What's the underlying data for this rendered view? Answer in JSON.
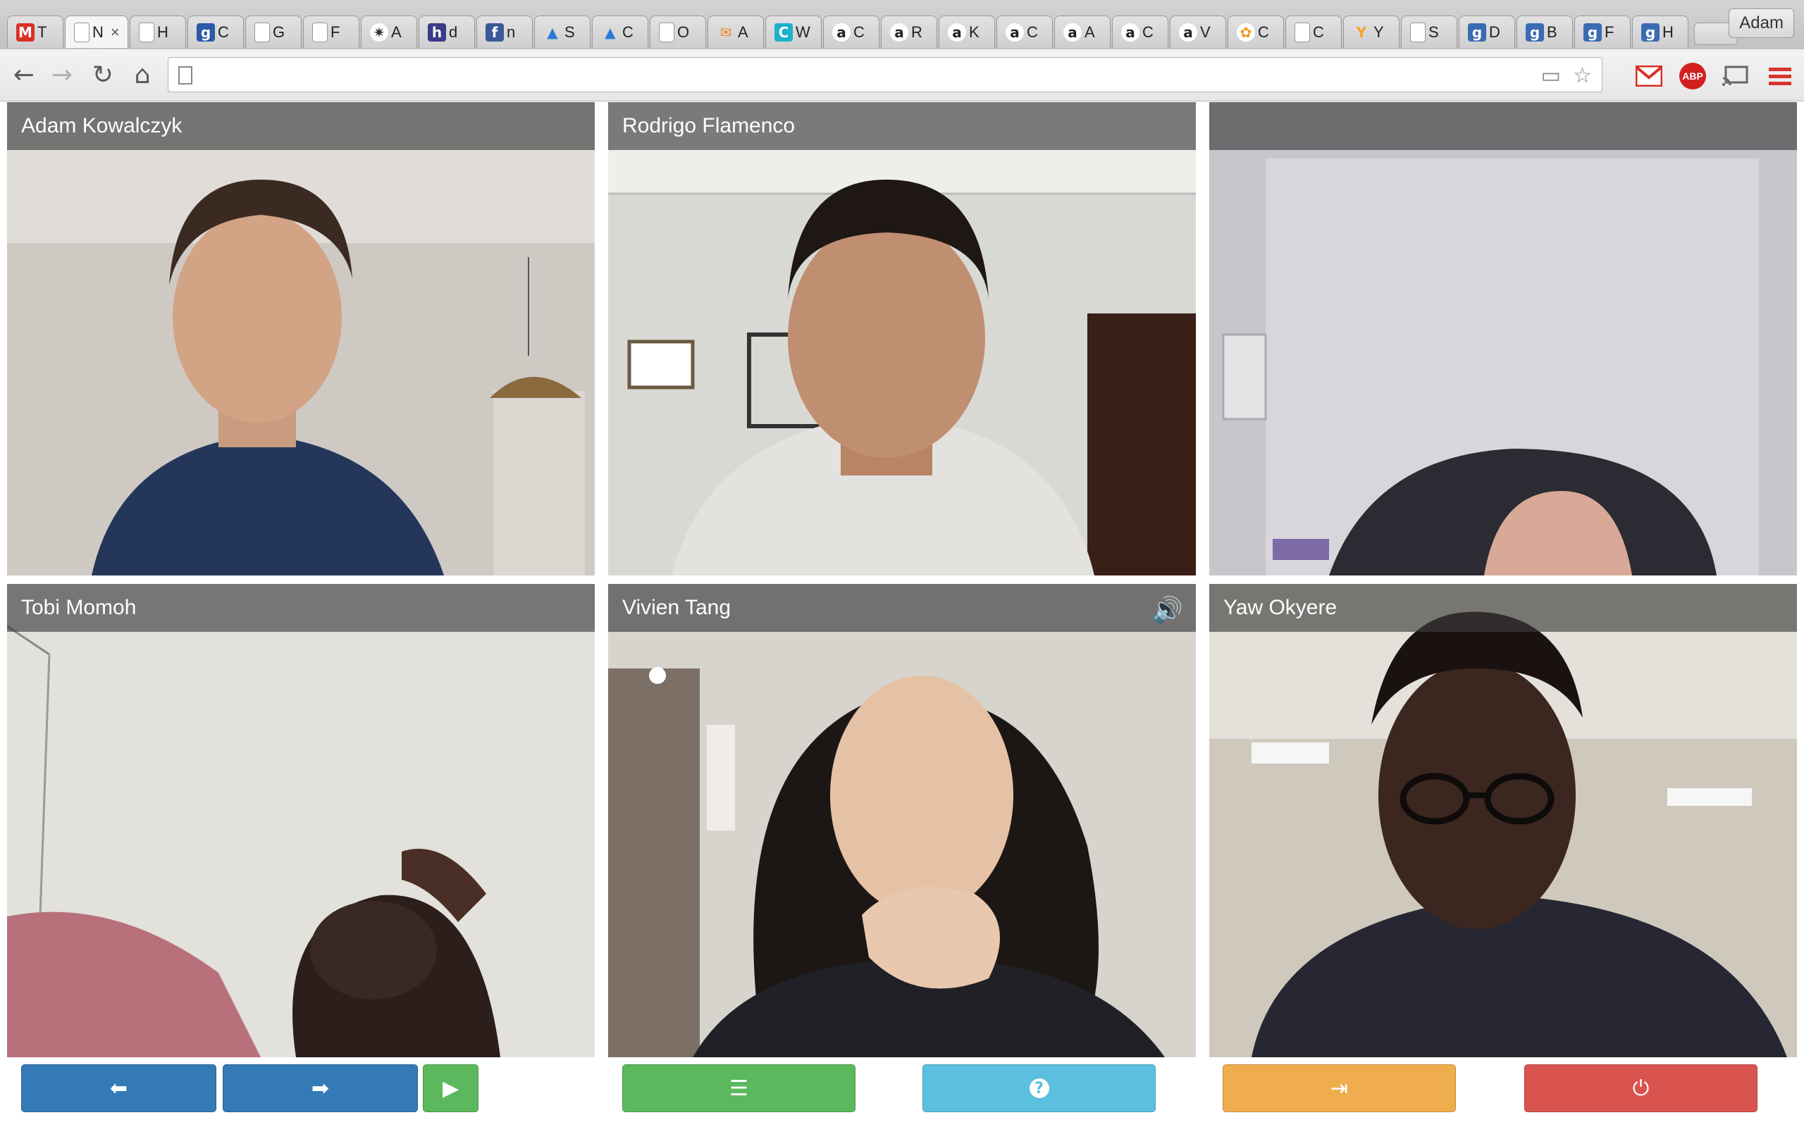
{
  "browser": {
    "profile_name": "Adam",
    "address": "",
    "tabs": [
      {
        "favicon": "gmail-icon",
        "glyph": "M",
        "color": "#d93025",
        "label": "T"
      },
      {
        "favicon": "page-icon",
        "glyph": "",
        "color": "#ffffff",
        "label": "N",
        "active": true
      },
      {
        "favicon": "apple-icon",
        "glyph": "",
        "color": "#555555",
        "label": "H"
      },
      {
        "favicon": "g-logo-icon",
        "glyph": "g",
        "color": "#2a5aa8",
        "label": "C"
      },
      {
        "favicon": "document-icon",
        "glyph": "",
        "color": "#ffffff",
        "label": "G"
      },
      {
        "favicon": "document-icon",
        "glyph": "",
        "color": "#ffffff",
        "label": "F"
      },
      {
        "favicon": "star-burst-icon",
        "glyph": "✷",
        "color": "#333333",
        "label": "A"
      },
      {
        "favicon": "h-logo-icon",
        "glyph": "h",
        "color": "#3b3a8a",
        "label": "d"
      },
      {
        "favicon": "facebook-icon",
        "glyph": "f",
        "color": "#3b5998",
        "label": "n"
      },
      {
        "favicon": "triangle-icon",
        "glyph": "▲",
        "color": "#2b7bd6",
        "label": "S"
      },
      {
        "favicon": "triangle-icon",
        "glyph": "▲",
        "color": "#2b7bd6",
        "label": "C"
      },
      {
        "favicon": "document-icon",
        "glyph": "",
        "color": "#ffffff",
        "label": "O"
      },
      {
        "favicon": "envelope-icon",
        "glyph": "✉",
        "color": "#f08a24",
        "label": "A"
      },
      {
        "favicon": "c-logo-icon",
        "glyph": "C",
        "color": "#1bb3c8",
        "label": "W"
      },
      {
        "favicon": "amazon-icon",
        "glyph": "a",
        "color": "#222222",
        "label": "C"
      },
      {
        "favicon": "amazon-icon",
        "glyph": "a",
        "color": "#222222",
        "label": "R"
      },
      {
        "favicon": "amazon-icon",
        "glyph": "a",
        "color": "#222222",
        "label": "K"
      },
      {
        "favicon": "amazon-icon",
        "glyph": "a",
        "color": "#222222",
        "label": "C"
      },
      {
        "favicon": "amazon-icon",
        "glyph": "a",
        "color": "#222222",
        "label": "A"
      },
      {
        "favicon": "amazon-icon",
        "glyph": "a",
        "color": "#222222",
        "label": "C"
      },
      {
        "favicon": "amazon-icon",
        "glyph": "a",
        "color": "#222222",
        "label": "V"
      },
      {
        "favicon": "puzzle-icon",
        "glyph": "✿",
        "color": "#f09a1a",
        "label": "C"
      },
      {
        "favicon": "document-icon",
        "glyph": "",
        "color": "#ffffff",
        "label": "C"
      },
      {
        "favicon": "y-logo-icon",
        "glyph": "Y",
        "color": "#f5a623",
        "label": "Y"
      },
      {
        "favicon": "document-icon",
        "glyph": "",
        "color": "#ffffff",
        "label": "S"
      },
      {
        "favicon": "goodreads-icon",
        "glyph": "g",
        "color": "#3b6bb3",
        "label": "D"
      },
      {
        "favicon": "goodreads-icon",
        "glyph": "g",
        "color": "#3b6bb3",
        "label": "B"
      },
      {
        "favicon": "goodreads-icon",
        "glyph": "g",
        "color": "#3b6bb3",
        "label": "F"
      },
      {
        "favicon": "goodreads-icon",
        "glyph": "g",
        "color": "#3b6bb3",
        "label": "H"
      }
    ]
  },
  "participants": [
    {
      "name": "Adam Kowalczyk",
      "speaking": false
    },
    {
      "name": "Rodrigo Flamenco",
      "speaking": false
    },
    {
      "name": "",
      "speaking": false
    },
    {
      "name": "Tobi Momoh",
      "speaking": false
    },
    {
      "name": "Vivien Tang",
      "speaking": true
    },
    {
      "name": "Yaw Okyere",
      "speaking": false
    }
  ],
  "controls": [
    {
      "icon": "arrow-left-icon",
      "glyph": "🡐",
      "style": "blue"
    },
    {
      "icon": "arrow-right-icon",
      "glyph": "🡒",
      "style": "blue"
    },
    {
      "icon": "play-icon",
      "glyph": "▶",
      "style": "green"
    },
    {
      "icon": "list-icon",
      "glyph": "☰",
      "style": "green"
    },
    {
      "icon": "help-icon",
      "glyph": "?",
      "style": "info"
    },
    {
      "icon": "exit-icon",
      "glyph": "⇥",
      "style": "orange"
    },
    {
      "icon": "power-icon",
      "glyph": "⏻",
      "style": "red"
    }
  ],
  "colors": {
    "speaking_outline": "#f1f23a",
    "btn_blue": "#337ab7",
    "btn_green": "#5cb85c",
    "btn_info": "#5bc0de",
    "btn_orange": "#f0ad4e",
    "btn_red": "#d9534f"
  }
}
